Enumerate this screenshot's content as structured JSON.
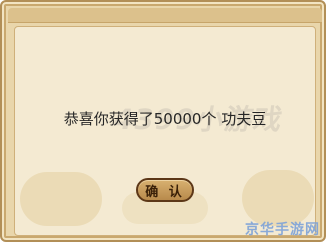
{
  "dialog": {
    "message": "恭喜你获得了50000个 功夫豆",
    "watermark": "4399小游戏",
    "confirm_label": "确 认"
  },
  "corner_watermark": "京华手游网",
  "colors": {
    "frame": "#b28f57",
    "panel": "#f4ead2",
    "text": "#262626",
    "button": "#c79d5c",
    "button_border": "#5c3717",
    "corner_watermark": "#7ea3d8"
  }
}
